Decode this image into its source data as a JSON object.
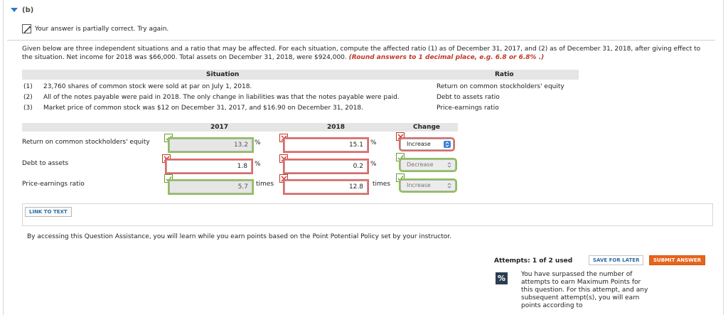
{
  "part": {
    "label": "(b)"
  },
  "status": {
    "message": "Your answer is partially correct.  Try again."
  },
  "intro": {
    "text": "Given below are three independent situations and a ratio that may be affected. For each situation, compute the affected ratio (1) as of December 31, 2017, and (2) as of December 31, 2018, after giving effect to the situation. Net income for 2018 was $66,000. Total assets on December 31, 2018, were $924,000. ",
    "note": "(Round answers to 1 decimal place, e.g. 6.8 or 6.8% .)"
  },
  "situations": {
    "header_situation": "Situation",
    "header_ratio": "Ratio",
    "rows": [
      {
        "num": "(1)",
        "text": "23,760 shares of common stock were sold at par on July 1, 2018.",
        "ratio": "Return on common stockholders' equity"
      },
      {
        "num": "(2)",
        "text": "All of the notes payable were paid in 2018. The only change in liabilities was that the notes payable were paid.",
        "ratio": "Debt to assets ratio"
      },
      {
        "num": "(3)",
        "text": "Market price of common stock was $12 on December 31, 2017, and $16.90 on December 31, 2018.",
        "ratio": "Price-earnings ratio"
      }
    ]
  },
  "grid": {
    "col_2017": "2017",
    "col_2018": "2018",
    "col_change": "Change",
    "rows": [
      {
        "label": "Return on common stockholders' equity",
        "v2017": "13.2",
        "s2017": "correct",
        "u2017": "%",
        "v2018": "15.1",
        "s2018": "wrong",
        "u2018": "%",
        "change": "Increase",
        "schange": "wrong"
      },
      {
        "label": "Debt to assets",
        "v2017": "1.8",
        "s2017": "wrong",
        "u2017": "%",
        "v2018": "0.2",
        "s2018": "wrong",
        "u2018": "%",
        "change": "Decrease",
        "schange": "correct"
      },
      {
        "label": "Price-earnings ratio",
        "v2017": "5.7",
        "s2017": "correct",
        "u2017": "times",
        "v2018": "12.8",
        "s2018": "wrong",
        "u2018": "times",
        "change": "Increase",
        "schange": "correct"
      }
    ]
  },
  "link_to_text": "LINK TO TEXT",
  "assistance": "By accessing this Question Assistance, you will learn while you earn points based on the Point Potential Policy set by your instructor.",
  "attempts": "Attempts: 1 of 2 used",
  "save_label": "SAVE FOR LATER",
  "submit_label": "SUBMIT ANSWER",
  "policy_icon": "%",
  "policy_text": "You have surpassed the number of attempts to earn Maximum Points for this question. For this attempt, and any subsequent attempt(s), you will earn points according to",
  "colors": {
    "correct": "#8cc152",
    "wrong": "#e06767",
    "submit": "#e8641b",
    "link": "#2e6da4"
  }
}
